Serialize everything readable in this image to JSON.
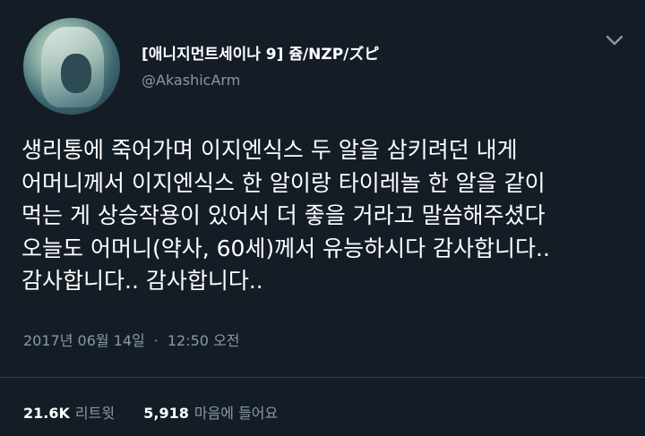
{
  "tweet": {
    "author": {
      "display_name": "[애니지먼트세이나 9] 쥼/NZP/ズピ",
      "handle": "@AkashicArm"
    },
    "text_lines": [
      "생리통에 죽어가며 이지엔식스 두 알을 삼키려던 내게",
      "어머니께서 이지엔식스 한 알이랑 타이레놀 한 알을 같이",
      "먹는 게 상승작용이 있어서 더 좋을 거라고 말씀해주셨다",
      "오늘도 어머니(약사, 60세)께서 유능하시다 감사합니다..",
      "감사합니다.. 감사합니다.."
    ],
    "date": "2017년 06월 14일",
    "separator": "·",
    "time": "12:50 오전",
    "retweets": {
      "count": "21.6K",
      "label": "리트윗"
    },
    "likes": {
      "count": "5,918",
      "label": "마음에 들어요"
    }
  },
  "icons": {
    "menu": "chevron-down-icon"
  },
  "colors": {
    "background": "#141d26",
    "text_primary": "#ffffff",
    "text_secondary": "#8899a6",
    "divider": "#2f3c48"
  }
}
